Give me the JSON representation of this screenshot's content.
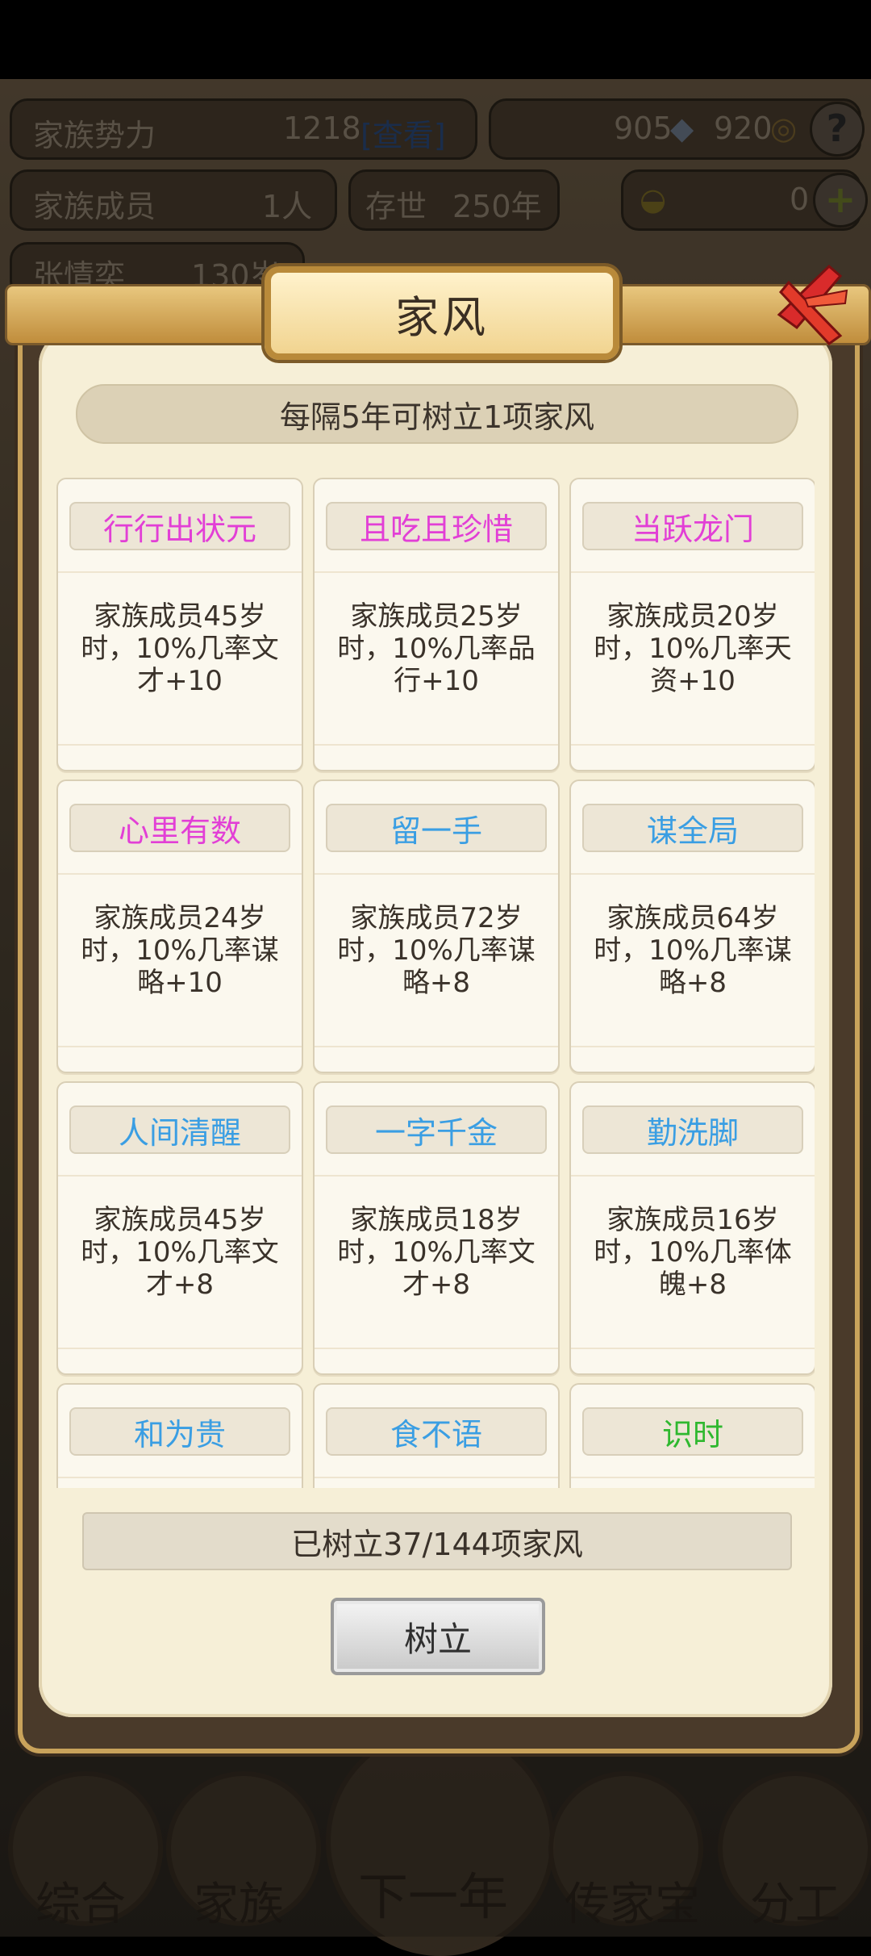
{
  "hud": {
    "power_label": "家族势力",
    "power_value": "1218",
    "power_link": "[查看]",
    "silver": "905",
    "copper": "920",
    "help": "?",
    "members_label": "家族成员",
    "members_value": "1人",
    "survive_label": "存世",
    "survive_value": "250年",
    "gold_value": "0",
    "plus": "+",
    "person_name": "张情奕",
    "person_age": "130岁"
  },
  "dialog": {
    "title": "家风",
    "notice": "每隔5年可树立1项家风",
    "cards": [
      {
        "name": "行行出状元",
        "color": "#e23fd6",
        "desc": "家族成员45岁时，10%几率文才+10"
      },
      {
        "name": "且吃且珍惜",
        "color": "#e23fd6",
        "desc": "家族成员25岁时，10%几率品行+10"
      },
      {
        "name": "当跃龙门",
        "color": "#e23fd6",
        "desc": "家族成员20岁时，10%几率天资+10"
      },
      {
        "name": "心里有数",
        "color": "#e23fd6",
        "desc": "家族成员24岁时，10%几率谋略+10"
      },
      {
        "name": "留一手",
        "color": "#3a9ee3",
        "desc": "家族成员72岁时，10%几率谋略+8"
      },
      {
        "name": "谋全局",
        "color": "#3a9ee3",
        "desc": "家族成员64岁时，10%几率谋略+8"
      },
      {
        "name": "人间清醒",
        "color": "#3a9ee3",
        "desc": "家族成员45岁时，10%几率文才+8"
      },
      {
        "name": "一字千金",
        "color": "#3a9ee3",
        "desc": "家族成员18岁时，10%几率文才+8"
      },
      {
        "name": "勤洗脚",
        "color": "#3a9ee3",
        "desc": "家族成员16岁时，10%几率体魄+8"
      },
      {
        "name": "和为贵",
        "color": "#3a9ee3",
        "desc": ""
      },
      {
        "name": "食不语",
        "color": "#3a9ee3",
        "desc": ""
      },
      {
        "name": "识时",
        "color": "#2fb82f",
        "desc": ""
      }
    ],
    "status": "已树立37/144项家风",
    "confirm_button": "树立"
  },
  "nav": {
    "items": [
      "综合",
      "家族",
      "下一年",
      "传家宝",
      "分工"
    ]
  }
}
